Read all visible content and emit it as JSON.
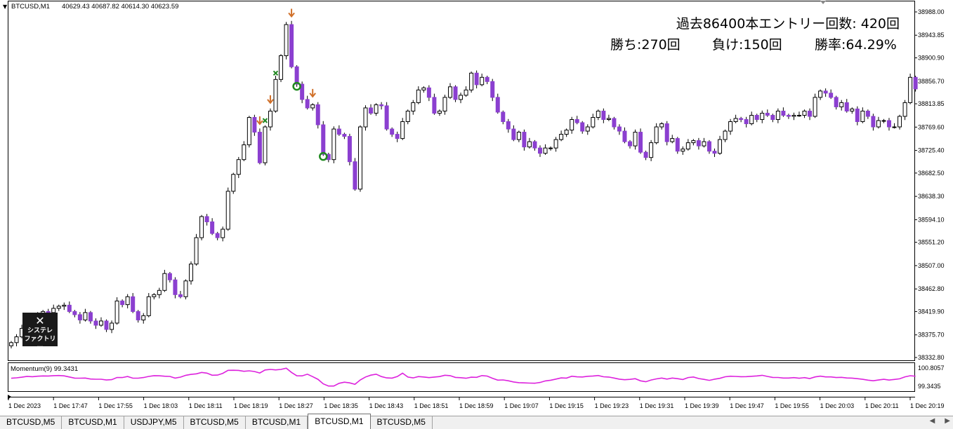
{
  "header": {
    "symbol": "BTCUSD,M1",
    "ohlc": "40629.43 40687.82 40614.30 40623.59"
  },
  "stats": {
    "line1": "過去86400本エントリー回数: 420回",
    "wins": "勝ち:270回",
    "losses": "負け:150回",
    "winrate": "勝率:64.29%"
  },
  "indicator": {
    "label": "Momentum(9) 99.3431"
  },
  "logo": {
    "icon": "tools-icon",
    "line1": "システレ",
    "line2": "ファクトリー"
  },
  "colors": {
    "bull_body": "#ffffff",
    "bear_body": "#8b3fd0",
    "wick": "#000000",
    "momentum": "#dd22dd",
    "arrow": "#d0702a",
    "cross": "#228822",
    "circle": "#1f8a1f"
  },
  "tabs": [
    {
      "label": "BTCUSD,M5",
      "active": false
    },
    {
      "label": "BTCUSD,M1",
      "active": false
    },
    {
      "label": "USDJPY,M5",
      "active": false
    },
    {
      "label": "BTCUSD,M5",
      "active": false
    },
    {
      "label": "BTCUSD,M1",
      "active": false
    },
    {
      "label": "BTCUSD,M1",
      "active": true
    },
    {
      "label": "BTCUSD,M5",
      "active": false
    }
  ],
  "chart_data": {
    "type": "candlestick",
    "title": "",
    "y_ticks": [
      "38988.00",
      "38943.85",
      "38900.90",
      "38856.70",
      "38813.85",
      "38769.60",
      "38725.40",
      "38682.50",
      "38638.30",
      "38594.10",
      "38551.20",
      "38507.00",
      "38462.80",
      "38419.90",
      "38375.70",
      "38332.80"
    ],
    "ylim": [
      38332.8,
      38988.0
    ],
    "x_ticks": [
      "1 Dec 2023",
      "1 Dec 17:47",
      "1 Dec 17:55",
      "1 Dec 18:03",
      "1 Dec 18:11",
      "1 Dec 18:19",
      "1 Dec 18:27",
      "1 Dec 18:35",
      "1 Dec 18:43",
      "1 Dec 18:51",
      "1 Dec 18:59",
      "1 Dec 19:07",
      "1 Dec 19:15",
      "1 Dec 19:23",
      "1 Dec 19:31",
      "1 Dec 19:39",
      "1 Dec 19:47",
      "1 Dec 19:55",
      "1 Dec 20:03",
      "1 Dec 20:11",
      "1 Dec 20:19"
    ],
    "close": [
      38361,
      38372,
      38388,
      38410,
      38401,
      38412,
      38420,
      38418,
      38426,
      38430,
      38432,
      38420,
      38414,
      38404,
      38418,
      38402,
      38394,
      38402,
      38386,
      38398,
      38440,
      38433,
      38448,
      38420,
      38404,
      38412,
      38448,
      38452,
      38460,
      38492,
      38480,
      38452,
      38448,
      38478,
      38510,
      38560,
      38600,
      38590,
      38568,
      38560,
      38576,
      38648,
      38680,
      38708,
      38736,
      38788,
      38760,
      38702,
      38770,
      38800,
      38860,
      38905,
      38964,
      38884,
      38851,
      38822,
      38806,
      38812,
      38774,
      38718,
      38708,
      38766,
      38756,
      38752,
      38704,
      38652,
      38770,
      38806,
      38796,
      38812,
      38810,
      38766,
      38756,
      38748,
      38780,
      38800,
      38816,
      38840,
      38844,
      38826,
      38796,
      38800,
      38826,
      38846,
      38822,
      38830,
      38840,
      38872,
      38850,
      38864,
      38856,
      38826,
      38798,
      38780,
      38766,
      38746,
      38760,
      38732,
      38742,
      38730,
      38720,
      38730,
      38730,
      38746,
      38756,
      38764,
      38784,
      38778,
      38762,
      38770,
      38788,
      38800,
      38784,
      38786,
      38770,
      38762,
      38742,
      38734,
      38760,
      38722,
      38712,
      38740,
      38770,
      38776,
      38742,
      38748,
      38724,
      38728,
      38740,
      38744,
      38734,
      38742,
      38724,
      38720,
      38746,
      38762,
      38780,
      38786,
      38784,
      38776,
      38792,
      38784,
      38796,
      38792,
      38784,
      38800,
      38792,
      38790,
      38792,
      38792,
      38800,
      38790,
      38826,
      38838,
      38834,
      38826,
      38808,
      38816,
      38800,
      38804,
      38780,
      38800,
      38790,
      38770,
      38782,
      38782,
      38770,
      38770,
      38790,
      38816,
      38864,
      38842
    ]
  }
}
